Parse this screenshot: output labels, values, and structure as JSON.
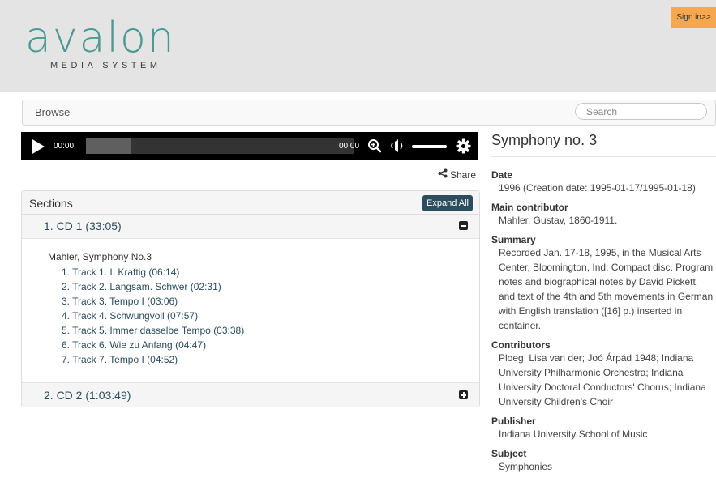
{
  "header": {
    "logo_word": "avalon",
    "logo_sub": "MEDIA SYSTEM",
    "signin_label": "Sign in>>"
  },
  "nav": {
    "browse_label": "Browse",
    "search_placeholder": "Search"
  },
  "player": {
    "current_time": "00:00",
    "duration": "00:00",
    "buffered_fraction": 0.17
  },
  "share_label": "Share",
  "sections": {
    "title": "Sections",
    "expand_all_label": "Expand All",
    "items": [
      {
        "label": "1. CD 1 (33:05)",
        "expanded": true,
        "work_title": "Mahler, Symphony No.3",
        "tracks": [
          "1. Track 1. I. Kraftig (06:14)",
          "2. Track 2. Langsam. Schwer (02:31)",
          "3. Track 3. Tempo I (03:06)",
          "4. Track 4. Schwungvoll (07:57)",
          "5. Track 5. Immer dasselbe Tempo (03:38)",
          "6. Track 6. Wie zu Anfang (04:47)",
          "7. Track 7. Tempo I (04:52)"
        ]
      },
      {
        "label": "2. CD 2 (1:03:49)",
        "expanded": false
      }
    ]
  },
  "metadata": {
    "title": "Symphony no. 3",
    "fields": [
      {
        "label": "Date",
        "value": "1996 (Creation date: 1995-01-17/1995-01-18)"
      },
      {
        "label": "Main contributor",
        "value": "Mahler, Gustav, 1860-1911."
      },
      {
        "label": "Summary",
        "value": "Recorded Jan. 17-18, 1995, in the Musical Arts Center, Bloomington, Ind. Compact disc. Program notes and biographical notes by David Pickett, and text of the 4th and 5th movements in German with English translation ([16] p.) inserted in container."
      },
      {
        "label": "Contributors",
        "value": "Ploeg, Lisa van der; Joó Árpád 1948; Indiana University Philharmonic Orchestra; Indiana University Doctoral Conductors' Chorus; Indiana University Children's Choir"
      },
      {
        "label": "Publisher",
        "value": "Indiana University School of Music"
      },
      {
        "label": "Subject",
        "value": "Symphonies"
      }
    ]
  },
  "colors": {
    "brand_teal": "#4a9a93",
    "signin_orange": "#f7a84e",
    "link_dark_blue": "#2b4d5e"
  }
}
